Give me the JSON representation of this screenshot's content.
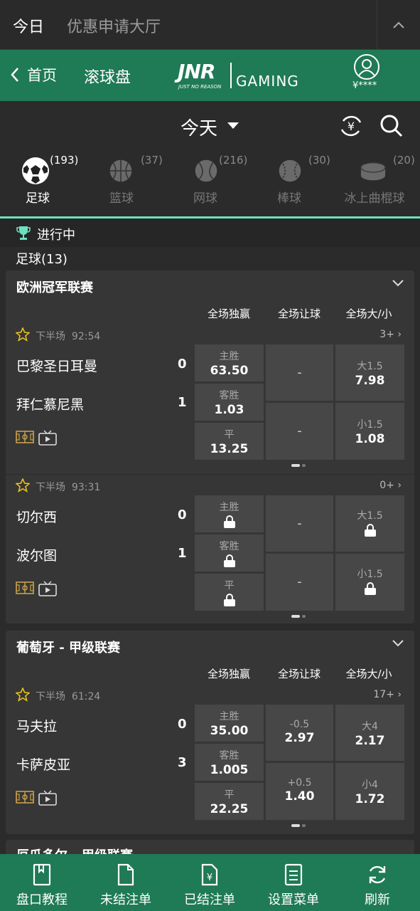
{
  "topbar": {
    "today": "今日",
    "promo": "优惠申请大厅"
  },
  "header": {
    "back_label": "首页",
    "title": "滚球盘",
    "logo_jnr": "JNR",
    "logo_tagline": "JUST NO REASON",
    "logo_gaming": "GAMING",
    "balance": "¥****"
  },
  "datebar": {
    "date": "今天"
  },
  "sports": [
    {
      "name": "足球",
      "count": "(193)",
      "active": true
    },
    {
      "name": "篮球",
      "count": "(37)"
    },
    {
      "name": "网球",
      "count": "(216)"
    },
    {
      "name": "棒球",
      "count": "(30)"
    },
    {
      "name": "冰上曲棍球",
      "count": "(20)"
    }
  ],
  "status": {
    "inplay": "进行中",
    "soccer_count": "足球(13)"
  },
  "columns": {
    "c1": "全场独赢",
    "c2": "全场让球",
    "c3": "全场大/小"
  },
  "leagues": [
    {
      "name": "欧洲冠军联赛",
      "matches": [
        {
          "period": "下半场",
          "time": "92:54",
          "more": "3+",
          "home": "巴黎圣日耳曼",
          "home_score": "0",
          "away": "拜仁慕尼黑",
          "away_score": "1",
          "win": [
            {
              "label": "主胜",
              "value": "63.50"
            },
            {
              "label": "客胜",
              "value": "1.03"
            },
            {
              "label": "平",
              "value": "13.25"
            }
          ],
          "handicap": [
            {
              "label": "",
              "value": "-"
            },
            {
              "label": "",
              "value": "-"
            }
          ],
          "total": [
            {
              "label": "大1.5",
              "value": "7.98"
            },
            {
              "label": "小1.5",
              "value": "1.08"
            }
          ]
        },
        {
          "period": "下半场",
          "time": "93:31",
          "more": "0+",
          "home": "切尔西",
          "home_score": "0",
          "away": "波尔图",
          "away_score": "1",
          "win": [
            {
              "label": "主胜",
              "value": ""
            },
            {
              "label": "客胜",
              "value": ""
            },
            {
              "label": "平",
              "value": ""
            }
          ],
          "handicap": [
            {
              "label": "",
              "value": "-"
            },
            {
              "label": "",
              "value": "-"
            }
          ],
          "total": [
            {
              "label": "大1.5",
              "value": ""
            },
            {
              "label": "小1.5",
              "value": ""
            }
          ]
        }
      ]
    },
    {
      "name": "葡萄牙 - 甲级联赛",
      "matches": [
        {
          "period": "下半场",
          "time": "61:24",
          "more": "17+",
          "home": "马夫拉",
          "home_score": "0",
          "away": "卡萨皮亚",
          "away_score": "3",
          "win": [
            {
              "label": "主胜",
              "value": "35.00"
            },
            {
              "label": "客胜",
              "value": "1.005"
            },
            {
              "label": "平",
              "value": "22.25"
            }
          ],
          "handicap": [
            {
              "label": "-0.5",
              "value": "2.97"
            },
            {
              "label": "+0.5",
              "value": "1.40"
            }
          ],
          "total": [
            {
              "label": "大4",
              "value": "2.17"
            },
            {
              "label": "小4",
              "value": "1.72"
            }
          ]
        }
      ]
    },
    {
      "name": "厄瓜多尔 - 甲级联赛"
    }
  ],
  "bottomnav": [
    {
      "label": "盘口教程"
    },
    {
      "label": "未结注单"
    },
    {
      "label": "已结注单"
    },
    {
      "label": "设置菜单"
    },
    {
      "label": "刷新"
    }
  ]
}
